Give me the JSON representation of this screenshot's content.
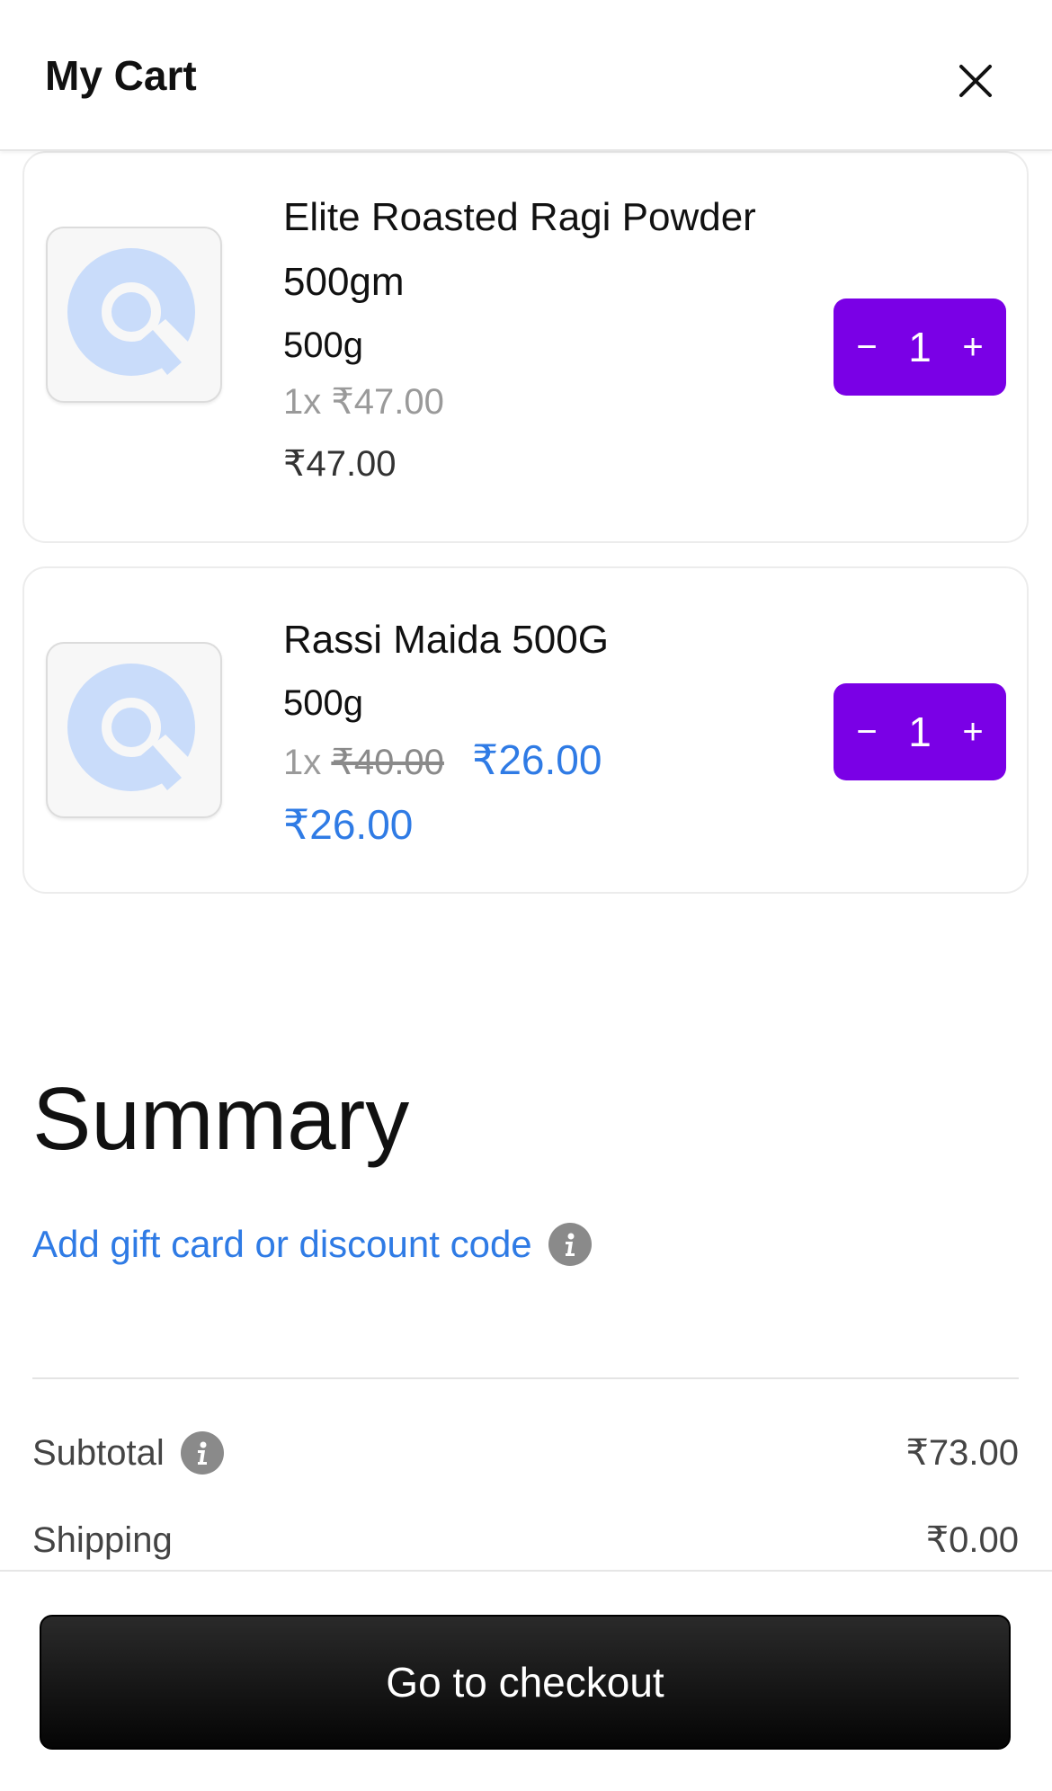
{
  "header": {
    "title": "My Cart",
    "close_icon": "close-icon"
  },
  "cart_items": [
    {
      "name_line1": "Elite Roasted Ragi Powder",
      "name_line2": "500gm",
      "variant": "500g",
      "unit_price": "1x ₹47.00",
      "line_total": "₹47.00",
      "quantity": "1",
      "thumbnail_icon": "product-placeholder-icon"
    },
    {
      "name_line1": "Rassi Maida 500G",
      "variant": "500g",
      "unit_prefix": "1x",
      "original_price": "₹40.00",
      "sale_price": "₹26.00",
      "line_total": "₹26.00",
      "quantity": "1",
      "thumbnail_icon": "product-placeholder-icon"
    }
  ],
  "stepper": {
    "decrement_symbol": "−",
    "increment_symbol": "+"
  },
  "summary": {
    "title": "Summary",
    "gift_link": "Add gift card or discount code",
    "subtotal_label": "Subtotal",
    "subtotal_value": "₹73.00",
    "shipping_label": "Shipping",
    "shipping_value": "₹0.00"
  },
  "footer": {
    "checkout_label": "Go to checkout"
  },
  "colors": {
    "accent_purple": "#7a00e6",
    "link_blue": "#2f7be5",
    "placeholder_blue": "#c9dcfa"
  }
}
